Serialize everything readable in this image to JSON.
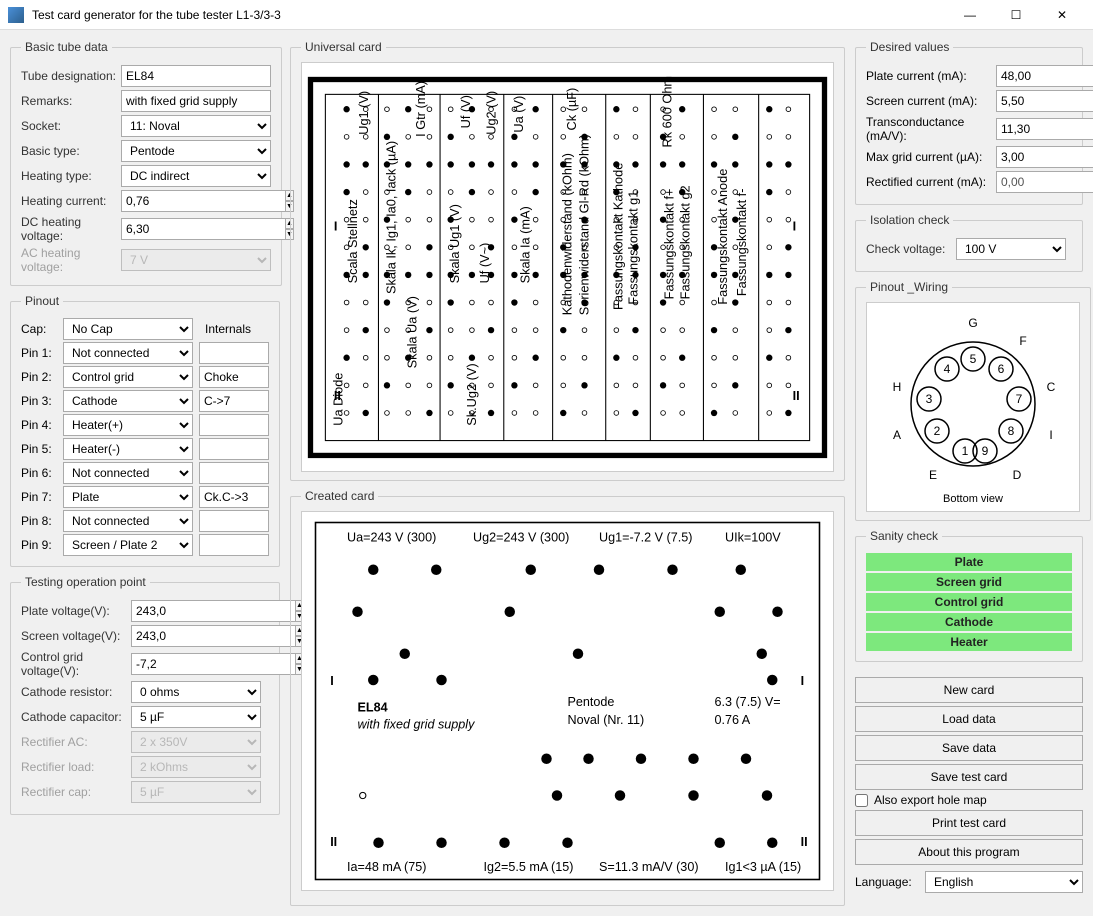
{
  "window": {
    "title": "Test card generator for the tube tester L1-3/3-3"
  },
  "basic": {
    "legend": "Basic tube data",
    "designation_label": "Tube designation:",
    "designation": "EL84",
    "remarks_label": "Remarks:",
    "remarks": "with fixed grid supply",
    "socket_label": "Socket:",
    "socket": "11: Noval",
    "type_label": "Basic type:",
    "type": "Pentode",
    "heating_type_label": "Heating type:",
    "heating_type": "DC indirect",
    "heating_current_label": "Heating current:",
    "heating_current": "0,76",
    "dc_heating_label": "DC heating voltage:",
    "dc_heating": "6,30",
    "ac_heating_label": "AC heating voltage:",
    "ac_heating": "7 V"
  },
  "pinout": {
    "legend": "Pinout",
    "cap_label": "Cap:",
    "cap": "No Cap",
    "internals_label": "Internals",
    "pins": [
      {
        "label": "Pin 1:",
        "value": "Not connected",
        "internal": ""
      },
      {
        "label": "Pin 2:",
        "value": "Control grid",
        "internal": "Choke"
      },
      {
        "label": "Pin 3:",
        "value": "Cathode",
        "internal": "C->7"
      },
      {
        "label": "Pin 4:",
        "value": "Heater(+)",
        "internal": ""
      },
      {
        "label": "Pin 5:",
        "value": "Heater(-)",
        "internal": ""
      },
      {
        "label": "Pin 6:",
        "value": "Not connected",
        "internal": ""
      },
      {
        "label": "Pin 7:",
        "value": "Plate",
        "internal": "Ck.C->3"
      },
      {
        "label": "Pin 8:",
        "value": "Not connected",
        "internal": ""
      },
      {
        "label": "Pin 9:",
        "value": "Screen / Plate 2",
        "internal": ""
      }
    ]
  },
  "testing": {
    "legend": "Testing operation point",
    "plate_v_label": "Plate voltage(V):",
    "plate_v": "243,0",
    "screen_v_label": "Screen voltage(V):",
    "screen_v": "243,0",
    "grid_v_label": "Control grid voltage(V):",
    "grid_v": "-7,2",
    "cathode_r_label": "Cathode resistor:",
    "cathode_r": "0 ohms",
    "cathode_c_label": "Cathode capacitor:",
    "cathode_c": "5 µF",
    "rect_ac_label": "Rectifier AC:",
    "rect_ac": "2 x 350V",
    "rect_load_label": "Rectifier load:",
    "rect_load": "2 kOhms",
    "rect_cap_label": "Rectifier cap:",
    "rect_cap": "5 µF"
  },
  "universal": {
    "legend": "Universal card"
  },
  "created": {
    "legend": "Created card",
    "ua": "Ua=243 V (300)",
    "ug2": "Ug2=243 V (300)",
    "ug1": "Ug1=-7.2 V (7.5)",
    "uik": "UIk=100V",
    "tube": "EL84",
    "remarks": "with fixed grid supply",
    "type": "Pentode",
    "socket": "Noval (Nr. 11)",
    "heat_v": "6.3 (7.5) V=",
    "heat_a": "0.76 A",
    "ia": "Ia=48 mA (75)",
    "ig2": "Ig2=5.5 mA (15)",
    "s": "S=11.3 mA/V (30)",
    "ig1": "Ig1<3 µA (15)"
  },
  "desired": {
    "legend": "Desired values",
    "plate_label": "Plate current (mA):",
    "plate": "48,00",
    "screen_label": "Screen current (mA):",
    "screen": "5,50",
    "trans_label": "Transconductance (mA/V):",
    "trans": "11,30",
    "max_grid_label": "Max grid current (µA):",
    "max_grid": "3,00",
    "rect_label": "Rectified current (mA):",
    "rect": "0,00"
  },
  "isolation": {
    "legend": "Isolation check",
    "check_label": "Check voltage:",
    "check": "100 V"
  },
  "wiring": {
    "legend": "Pinout _Wiring",
    "bottom_view": "Bottom view",
    "labels": [
      "G",
      "F",
      "C",
      "I",
      "D",
      "E",
      "A",
      "H"
    ],
    "pins": [
      "1",
      "2",
      "3",
      "4",
      "5",
      "6",
      "7",
      "8",
      "9"
    ]
  },
  "sanity": {
    "legend": "Sanity check",
    "items": [
      "Plate",
      "Screen grid",
      "Control grid",
      "Cathode",
      "Heater"
    ]
  },
  "buttons": {
    "new": "New card",
    "load": "Load data",
    "save": "Save data",
    "save_test": "Save test card",
    "export_chk": "Also export hole map",
    "print": "Print test card",
    "about": "About this program"
  },
  "language": {
    "label": "Language:",
    "value": "English"
  }
}
